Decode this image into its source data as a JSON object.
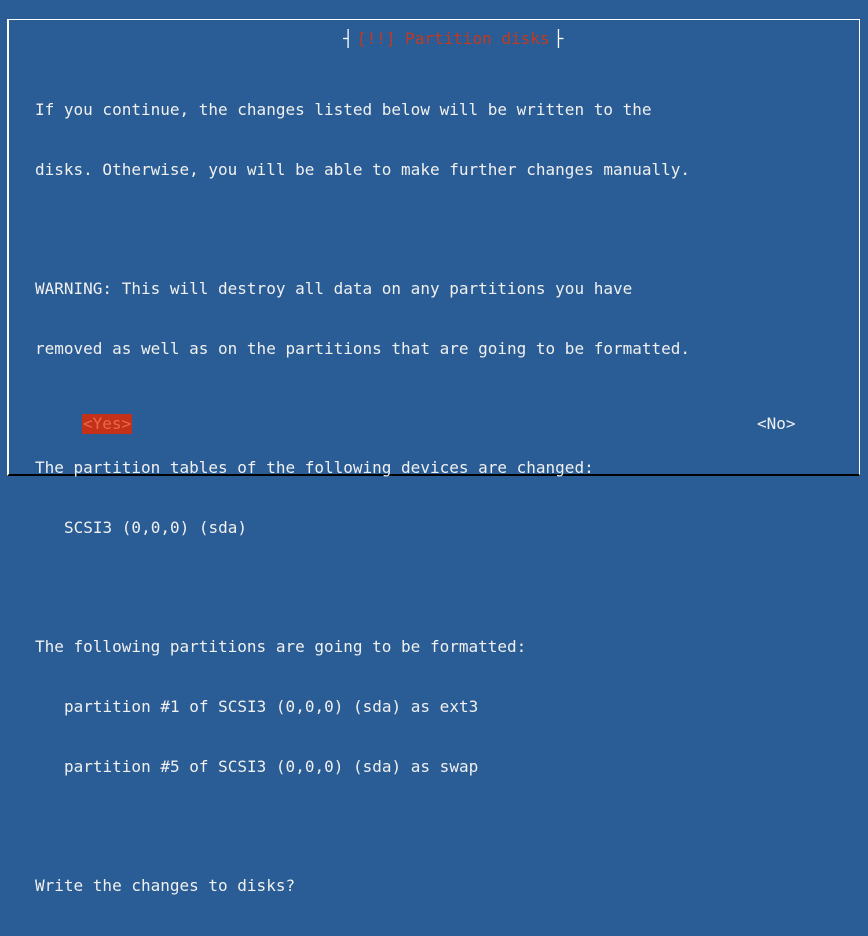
{
  "dialog": {
    "title": "[!!] Partition disks",
    "paragraphs": {
      "intro_1": "If you continue, the changes listed below will be written to the",
      "intro_2": "disks. Otherwise, you will be able to make further changes manually.",
      "warning_1": "WARNING: This will destroy all data on any partitions you have",
      "warning_2": "removed as well as on the partitions that are going to be formatted.",
      "tables_heading": "The partition tables of the following devices are changed:",
      "tables_device": "SCSI3 (0,0,0) (sda)",
      "format_heading": "The following partitions are going to be formatted:",
      "format_items": [
        "partition #1 of SCSI3 (0,0,0) (sda) as ext3",
        "partition #5 of SCSI3 (0,0,0) (sda) as swap"
      ],
      "question": "Write the changes to disks?"
    },
    "buttons": {
      "yes_label": "<Yes>",
      "no_label": "<No>"
    }
  },
  "colors": {
    "background": "#2a5d95",
    "title_text": "#c43820",
    "selected_button_bg": "#c43018",
    "text": "#f0f0f0"
  }
}
